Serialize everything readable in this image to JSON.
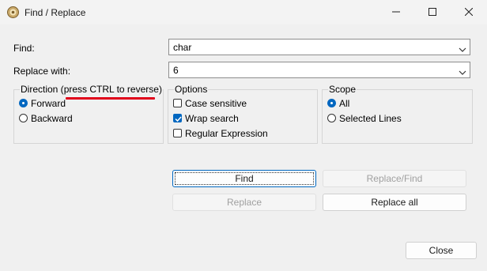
{
  "window": {
    "title": "Find / Replace",
    "icons": [
      "app-icon",
      "minimize-icon",
      "maximize-icon",
      "close-icon"
    ]
  },
  "find": {
    "label": "Find:",
    "value": "char"
  },
  "replace": {
    "label": "Replace with:",
    "value": "6"
  },
  "direction": {
    "title_prefix": "Direction (",
    "title_highlight": "press CTRL to reverse",
    "title_suffix": ")",
    "options": [
      "Forward",
      "Backward"
    ],
    "selected": "Forward"
  },
  "options": {
    "title": "Options",
    "case_sensitive": {
      "label": "Case sensitive",
      "checked": false
    },
    "wrap_search": {
      "label": "Wrap search",
      "checked": true
    },
    "regular_expression": {
      "label": "Regular Expression",
      "checked": false
    }
  },
  "scope": {
    "title": "Scope",
    "options": [
      "All",
      "Selected Lines"
    ],
    "selected": "All"
  },
  "buttons": {
    "find": "Find",
    "replace_find": "Replace/Find",
    "replace": "Replace",
    "replace_all": "Replace all",
    "close": "Close"
  },
  "colors": {
    "accent": "#0067c0",
    "annotation_underline": "#e0001a"
  }
}
